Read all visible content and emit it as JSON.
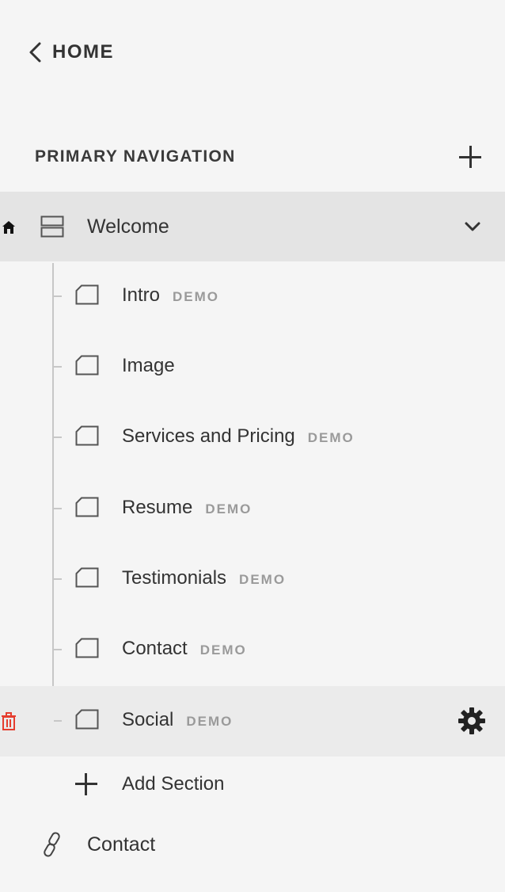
{
  "nav": {
    "back_label": "HOME"
  },
  "section": {
    "title": "PRIMARY NAVIGATION"
  },
  "page": {
    "label": "Welcome"
  },
  "sections": [
    {
      "label": "Intro",
      "badge": "DEMO"
    },
    {
      "label": "Image",
      "badge": ""
    },
    {
      "label": "Services and Pricing",
      "badge": "DEMO"
    },
    {
      "label": "Resume",
      "badge": "DEMO"
    },
    {
      "label": "Testimonials",
      "badge": "DEMO"
    },
    {
      "label": "Contact",
      "badge": "DEMO"
    },
    {
      "label": "Social",
      "badge": "DEMO"
    }
  ],
  "add_section_label": "Add Section",
  "link_item": {
    "label": "Contact"
  },
  "colors": {
    "background": "#f5f5f5",
    "active_row": "#e4e4e4",
    "hover_row": "#ebebeb",
    "delete": "#e53e2f",
    "badge": "#9a9a9a"
  }
}
